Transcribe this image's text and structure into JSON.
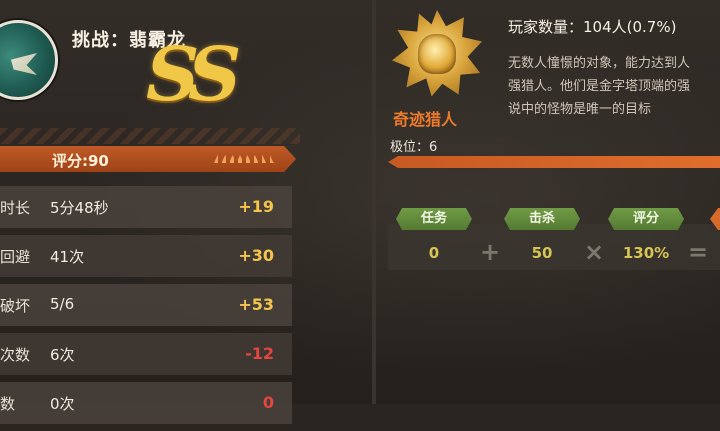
{
  "challenge": {
    "title": "挑战：翡霸龙",
    "grade": "SS"
  },
  "score": {
    "label": "评分:90"
  },
  "stats": [
    {
      "label": "时长",
      "value": "5分48秒",
      "points": "+19",
      "sign": "pos"
    },
    {
      "label": "回避",
      "value": "41次",
      "points": "+30",
      "sign": "pos"
    },
    {
      "label": "破坏",
      "value": "5/6",
      "points": "+53",
      "sign": "pos"
    },
    {
      "label": "次数",
      "value": "6次",
      "points": "-12",
      "sign": "neg"
    },
    {
      "label": "数",
      "value": "0次",
      "points": "0",
      "sign": "neg"
    }
  ],
  "rank": {
    "name": "奇迹猎人",
    "position": "极位：6",
    "players": "玩家数量：104人(0.7%)",
    "description": [
      "无数人憧憬的对象，能力达到人",
      "强猎人。他们是金字塔顶端的强",
      "说中的怪物是唯一的目标"
    ]
  },
  "calc": {
    "mission": {
      "label": "任务",
      "value": "0"
    },
    "kill": {
      "label": "击杀",
      "value": "50"
    },
    "rating": {
      "label": "评分",
      "value": "130%"
    },
    "op_plus": "+",
    "op_times": "×",
    "op_equals": "="
  },
  "colors": {
    "accent": "#ee7a2b",
    "positive": "#f4c54d",
    "negative": "#e4463f",
    "tag": "#6f9b45"
  }
}
